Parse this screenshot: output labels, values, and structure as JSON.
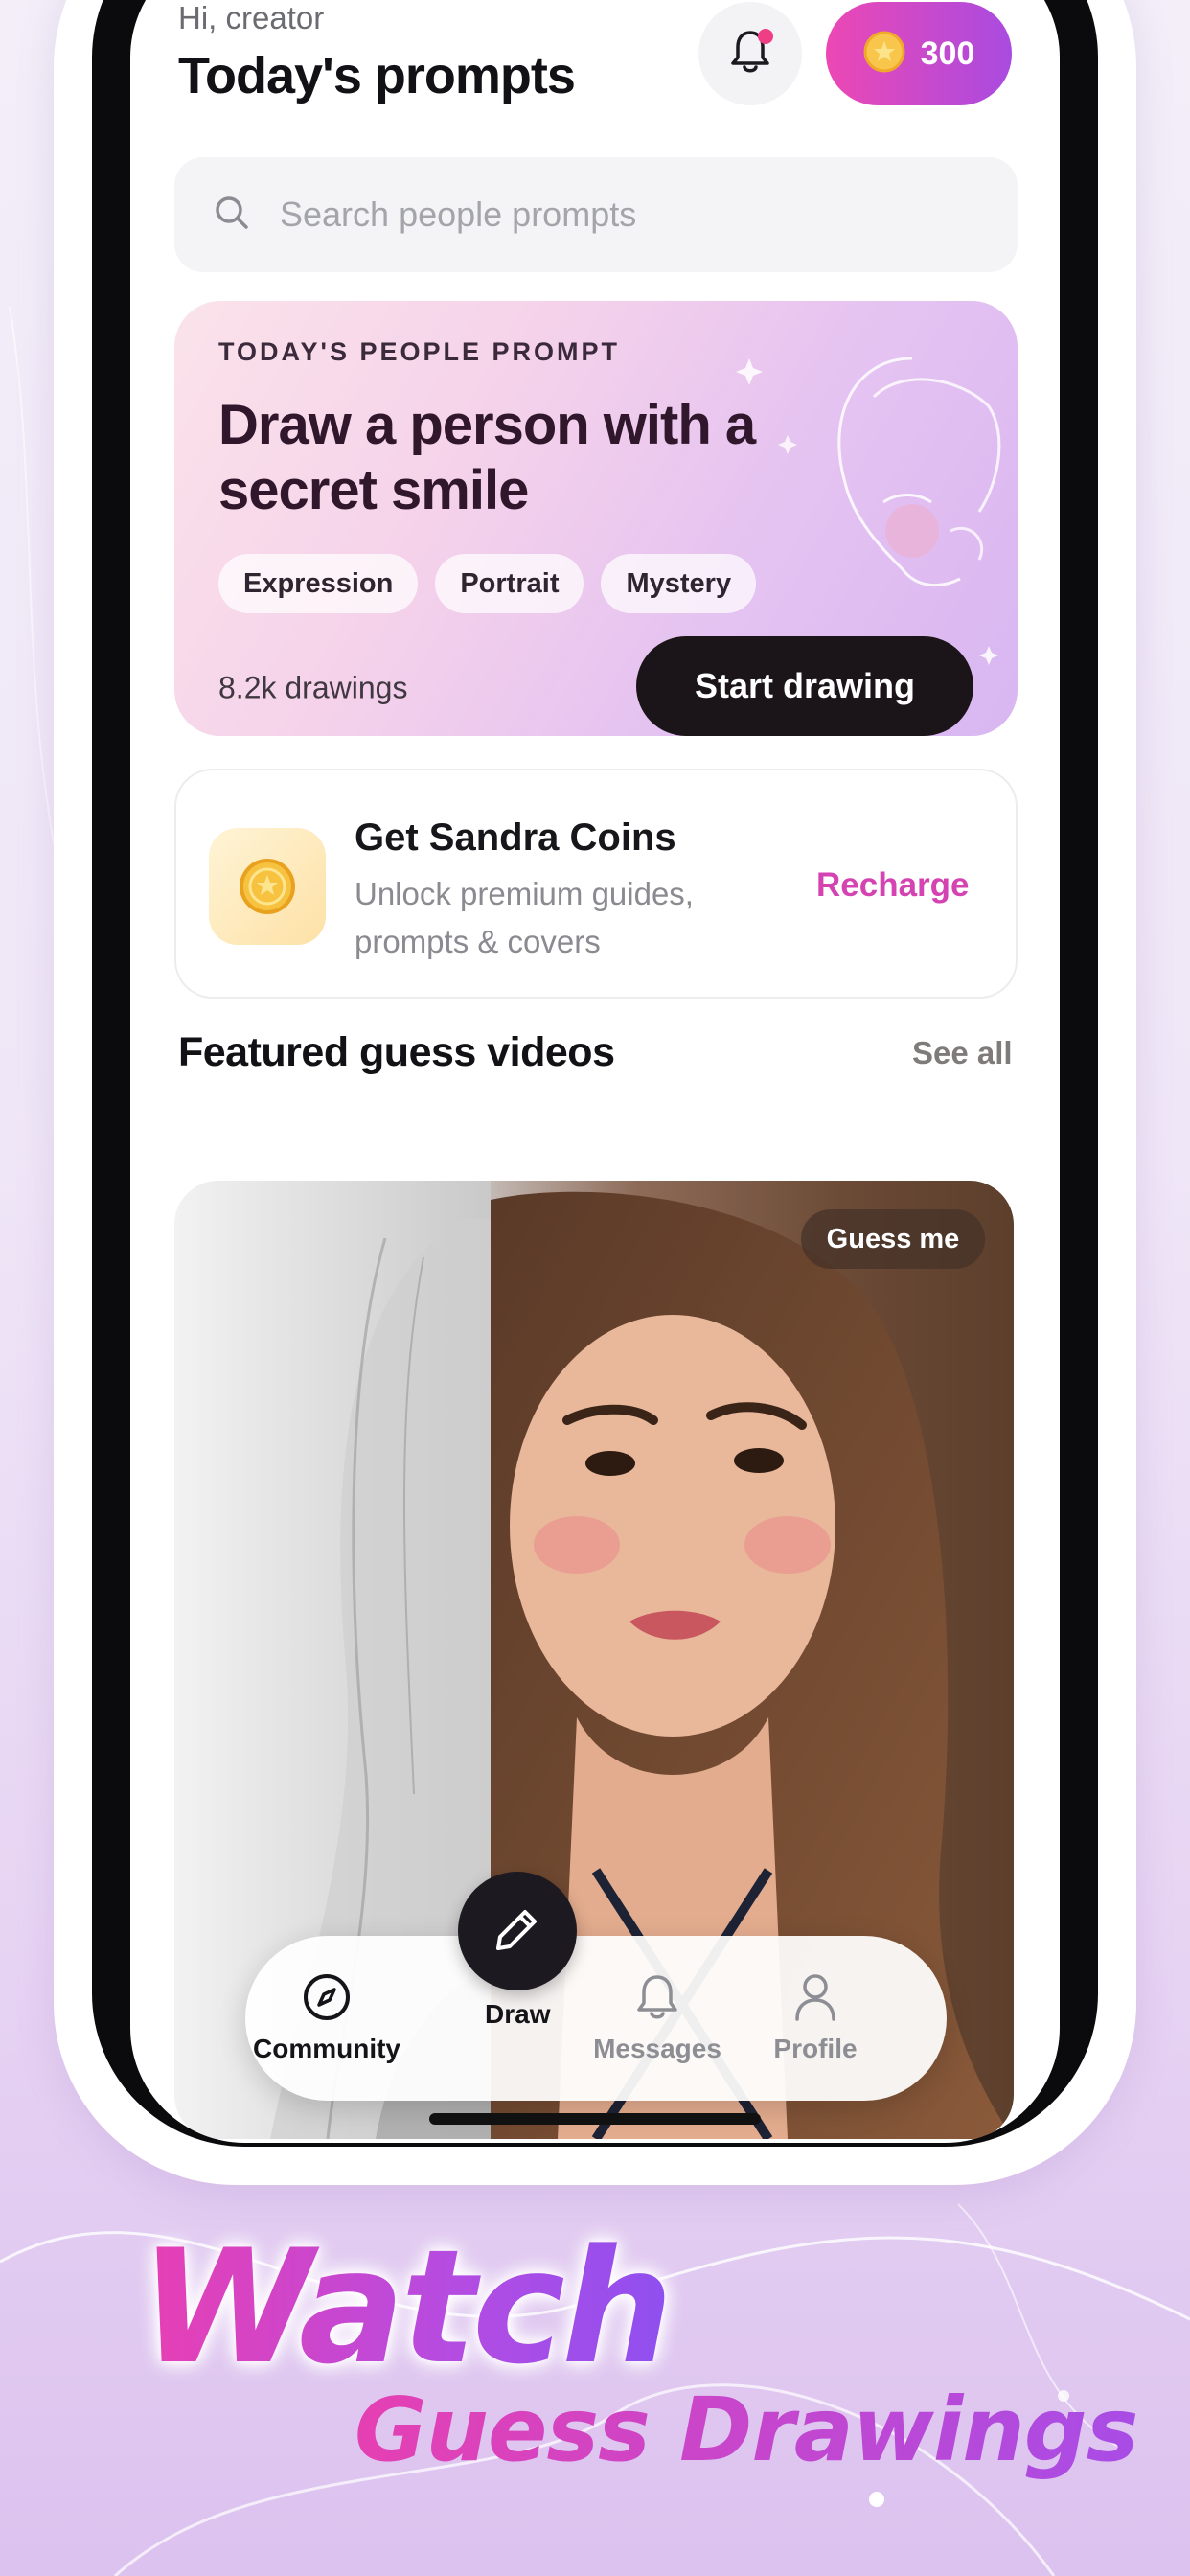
{
  "header": {
    "greeting": "Hi, creator",
    "title": "Today's prompts",
    "coins": "300"
  },
  "search": {
    "placeholder": "Search people prompts"
  },
  "prompt_card": {
    "kicker": "TODAY'S PEOPLE PROMPT",
    "title": "Draw a person with a secret smile",
    "tags": [
      "Expression",
      "Portrait",
      "Mystery"
    ],
    "drawings_count": "8.2k drawings",
    "cta": "Start drawing"
  },
  "coins_card": {
    "title": "Get Sandra Coins",
    "subtitle": "Unlock premium guides, prompts & covers",
    "action": "Recharge"
  },
  "featured": {
    "title": "Featured guess videos",
    "see_all": "See all",
    "badge": "Guess me"
  },
  "tabbar": {
    "community": "Community",
    "draw": "Draw",
    "messages": "Messages",
    "profile": "Profile"
  },
  "marketing": {
    "headline": "Watch",
    "subheadline": "Guess Drawings"
  },
  "colors": {
    "accent_pink": "#ec48b4",
    "accent_purple": "#a94be0",
    "notification_dot": "#ef3e86",
    "recharge_text": "#d543b3",
    "dark_button": "#1b1519"
  },
  "icons": {
    "bell": "bell-icon",
    "coin": "coin-icon",
    "search": "search-icon",
    "compass": "compass-icon",
    "pencil": "pencil-icon",
    "person": "person-icon"
  }
}
